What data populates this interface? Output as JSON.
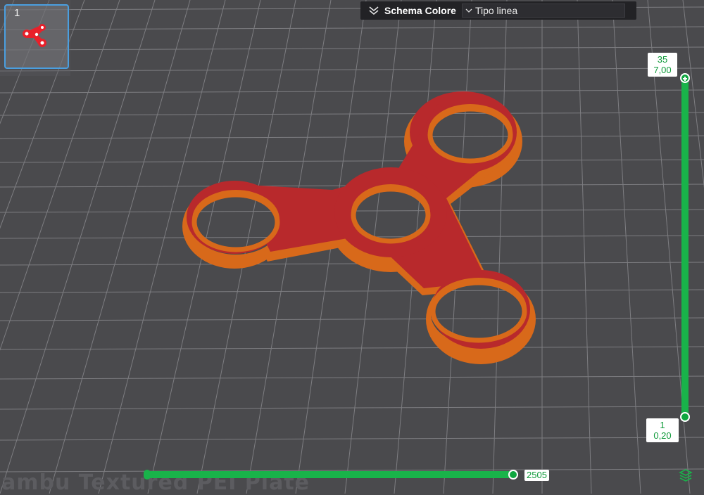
{
  "plate": {
    "number": "1",
    "name": "ambu Textured PEI Plate"
  },
  "toolbar": {
    "scheme_label": "Schema Colore",
    "line_type_value": "Tipo linea",
    "icons": {
      "collapse": "double-chevron-down-icon",
      "dropdown": "chevron-down-icon"
    }
  },
  "layer_slider": {
    "top_layer": "35",
    "top_height": "7,00",
    "bottom_layer": "1",
    "bottom_height": "0,20",
    "top_fraction": 1.0,
    "bottom_fraction": 0.0
  },
  "move_slider": {
    "value": "2505",
    "position_fraction": 1.0
  },
  "colors": {
    "accent_green": "#19b34a",
    "model_top": "#b8292c",
    "model_wall": "#d8691a",
    "plate_bg": "#4a4a4d",
    "grid": "#8a8a8e",
    "selection_border": "#4a9fe0"
  },
  "icons": {
    "layers": "layers-icon"
  }
}
